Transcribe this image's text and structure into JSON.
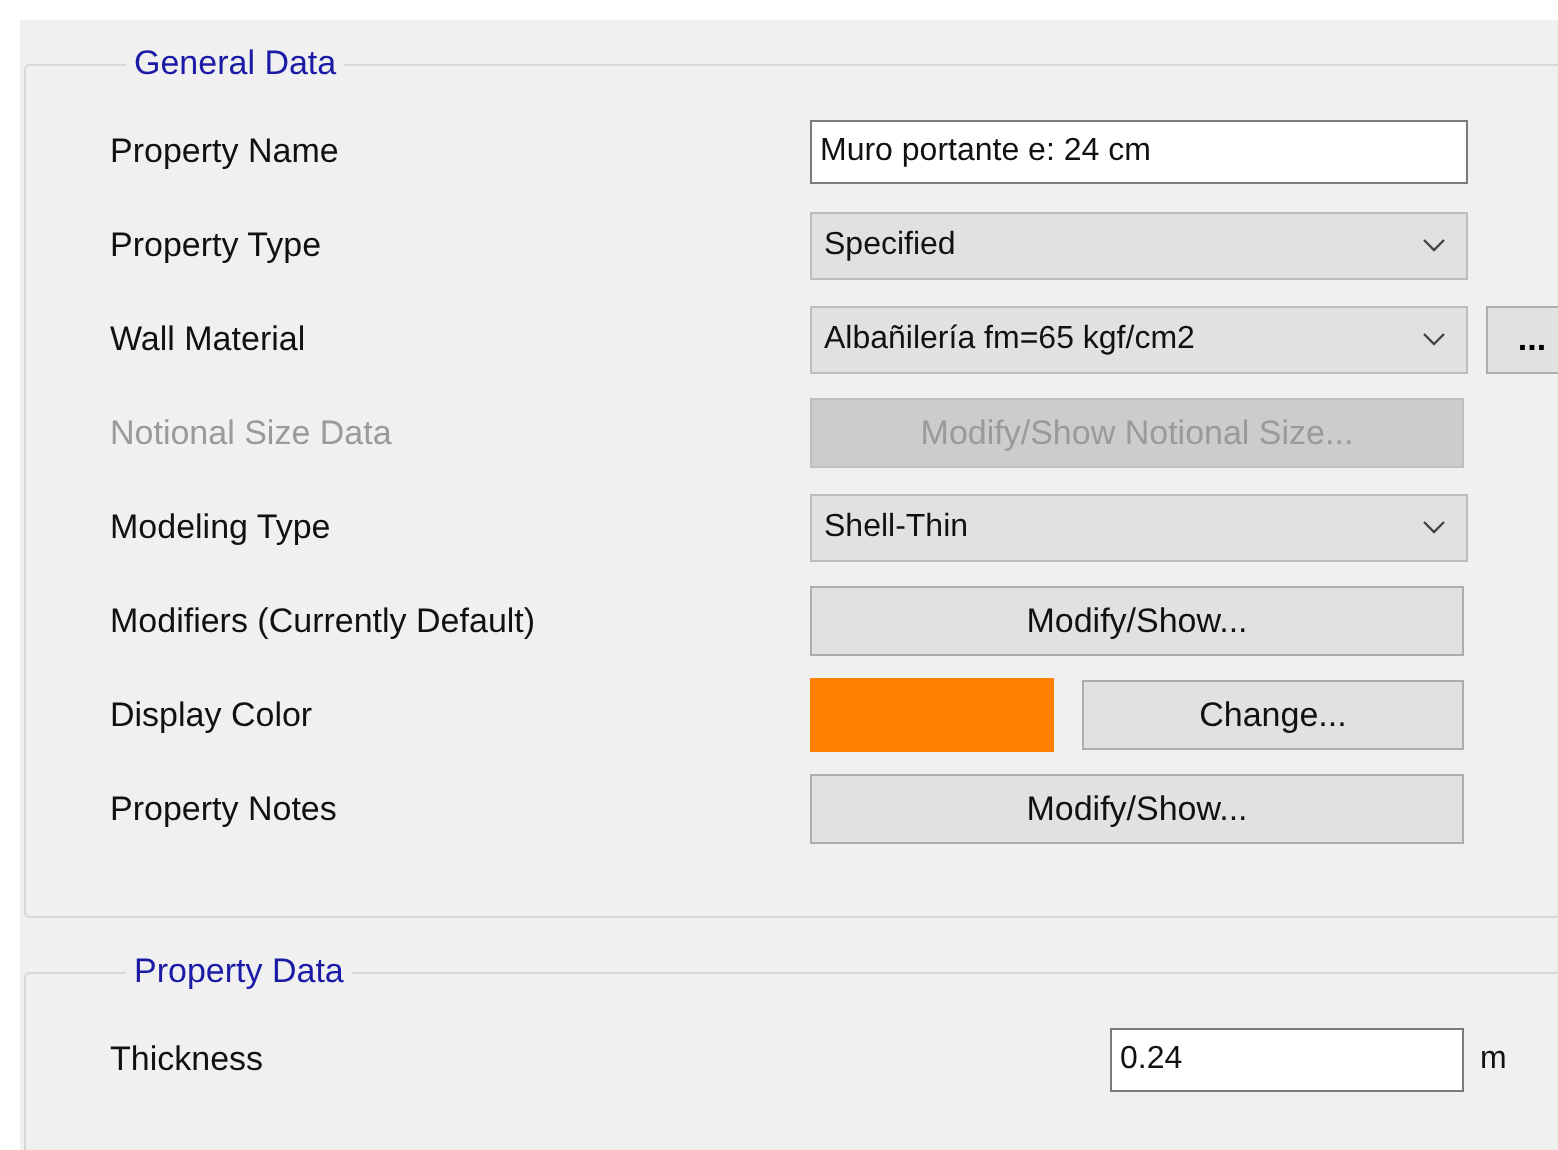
{
  "general_data": {
    "title": "General Data",
    "rows": [
      {
        "label": "Property Name",
        "disabled": false,
        "control": {
          "kind": "text",
          "value": "Muro portante e: 24 cm"
        }
      },
      {
        "label": "Property Type",
        "disabled": false,
        "control": {
          "kind": "combo",
          "value": "Specified"
        }
      },
      {
        "label": "Wall Material",
        "disabled": false,
        "control": {
          "kind": "combo",
          "value": "Albañilería fm=65 kgf/cm2",
          "extra_button": "..."
        }
      },
      {
        "label": "Notional Size Data",
        "disabled": true,
        "control": {
          "kind": "button",
          "label": "Modify/Show Notional Size...",
          "disabled": true
        }
      },
      {
        "label": "Modeling Type",
        "disabled": false,
        "control": {
          "kind": "combo",
          "value": "Shell-Thin"
        }
      },
      {
        "label": "Modifiers (Currently Default)",
        "disabled": false,
        "control": {
          "kind": "button",
          "label": "Modify/Show...",
          "disabled": false
        }
      },
      {
        "label": "Display Color",
        "disabled": false,
        "control": {
          "kind": "color",
          "color": "#ff8000",
          "button": "Change..."
        }
      },
      {
        "label": "Property Notes",
        "disabled": false,
        "control": {
          "kind": "button",
          "label": "Modify/Show...",
          "disabled": false
        }
      }
    ]
  },
  "property_data": {
    "title": "Property Data",
    "rows": [
      {
        "label": "Thickness",
        "value": "0.24",
        "unit": "m"
      }
    ]
  }
}
